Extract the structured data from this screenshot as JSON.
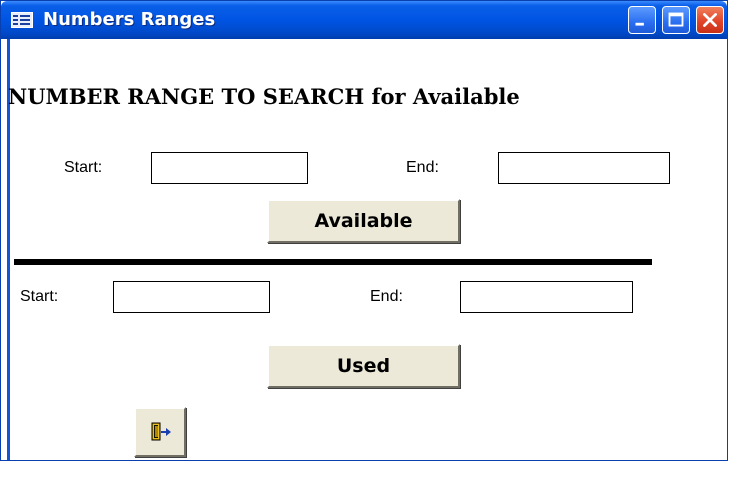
{
  "window": {
    "title": "Numbers Ranges"
  },
  "form": {
    "heading": "NUMBER RANGE TO SEARCH for Available",
    "available_section": {
      "start_label": "Start:",
      "end_label": "End:",
      "start_value": "",
      "end_value": "",
      "button_label": "Available"
    },
    "used_section": {
      "start_label": "Start:",
      "end_label": "End:",
      "start_value": "",
      "end_value": "",
      "button_label": "Used"
    },
    "exit_button_icon": "exit-door-icon"
  },
  "colors": {
    "titlebar": "#0054e3",
    "close_button": "#e0452a",
    "button_face": "#ece9d8"
  }
}
